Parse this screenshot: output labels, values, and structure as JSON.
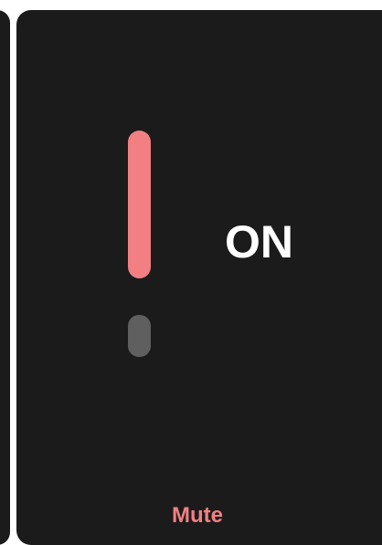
{
  "colors": {
    "panel_background": "#1b1b1b",
    "accent": "#f28083",
    "knob": "#5f5f5f",
    "text_primary": "#ffffff"
  },
  "toggle": {
    "state_label": "ON",
    "is_on": true,
    "action_label": "Mute"
  }
}
